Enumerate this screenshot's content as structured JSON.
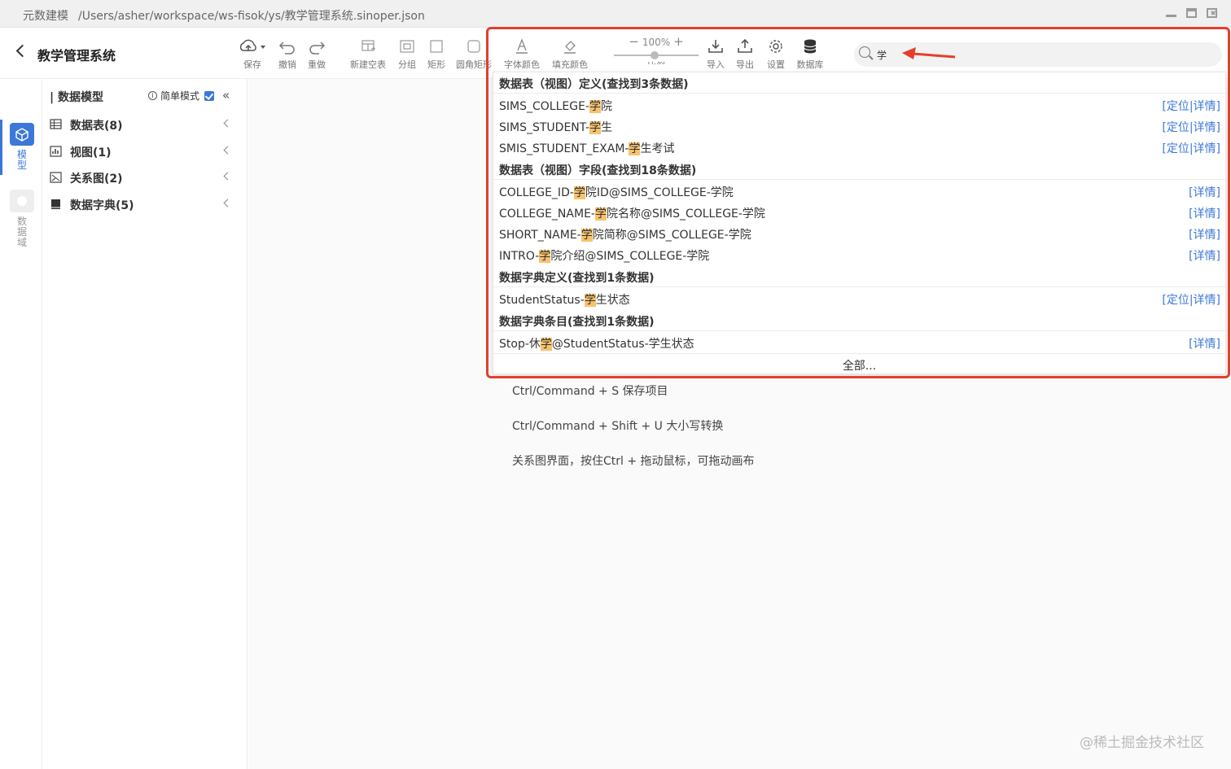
{
  "window": {
    "app_name": "元数建模",
    "file_path": "/Users/asher/workspace/ws-fisok/ys/教学管理系统.sinoper.json"
  },
  "header": {
    "project_title": "教学管理系统"
  },
  "toolbar": {
    "save": "保存",
    "undo": "撤销",
    "redo": "重做",
    "new_table": "新建空表",
    "group": "分组",
    "rect": "矩形",
    "rounded_rect": "圆角矩形",
    "font_color": "字体颜色",
    "fill_color": "填充颜色",
    "zoom": "100%",
    "zoom_label": "比例",
    "import": "导入",
    "export": "导出",
    "settings": "设置",
    "database": "数据库"
  },
  "search": {
    "value": "学"
  },
  "side_tabs": {
    "model": "模型",
    "data_domain": "数据域"
  },
  "sidebar": {
    "title": "数据模型",
    "simple_mode": "简单模式",
    "items": [
      {
        "label": "数据表(8)",
        "icon": "table-icon"
      },
      {
        "label": "视图(1)",
        "icon": "view-icon"
      },
      {
        "label": "关系图(2)",
        "icon": "relation-diagram-icon"
      },
      {
        "label": "数据字典(5)",
        "icon": "dictionary-icon"
      }
    ]
  },
  "dropdown": {
    "sections": [
      {
        "title": "数据表（视图）定义(查找到3条数据)"
      },
      {
        "title": "数据表（视图）字段(查找到18条数据)"
      },
      {
        "title": "数据字典定义(查找到1条数据)"
      },
      {
        "title": "数据字典条目(查找到1条数据)"
      }
    ],
    "rows": [
      {
        "pre": "SIMS_COLLEGE-",
        "hit": "学",
        "post": "院",
        "actions": "[定位|详情]"
      },
      {
        "pre": "SIMS_STUDENT-",
        "hit": "学",
        "post": "生",
        "actions": "[定位|详情]"
      },
      {
        "pre": "SMIS_STUDENT_EXAM-",
        "hit": "学",
        "post": "生考试",
        "actions": "[定位|详情]"
      },
      {
        "pre": "COLLEGE_ID-",
        "hit": "学",
        "post": "院ID@SIMS_COLLEGE-学院",
        "actions": "[详情]"
      },
      {
        "pre": "COLLEGE_NAME-",
        "hit": "学",
        "post": "院名称@SIMS_COLLEGE-学院",
        "actions": "[详情]"
      },
      {
        "pre": "SHORT_NAME-",
        "hit": "学",
        "post": "院简称@SIMS_COLLEGE-学院",
        "actions": "[详情]"
      },
      {
        "pre": "INTRO-",
        "hit": "学",
        "post": "院介绍@SIMS_COLLEGE-学院",
        "actions": "[详情]"
      },
      {
        "pre": "StudentStatus-",
        "hit": "学",
        "post": "生状态",
        "actions": "[定位|详情]"
      },
      {
        "pre": "Stop-休",
        "hit": "学",
        "post": "@StudentStatus-学生状态",
        "actions": "[详情]"
      }
    ],
    "all": "全部..."
  },
  "tips": [
    "Ctrl/Command + S 保存项目",
    "Ctrl/Command + Shift + U 大小写转换",
    "关系图界面，按住Ctrl + 拖动鼠标，可拖动画布"
  ],
  "watermark": "@稀土掘金技术社区",
  "colors": {
    "accent": "#3c78d8",
    "highlight": "#f7c26d",
    "annotation_red": "#e53e2e"
  }
}
